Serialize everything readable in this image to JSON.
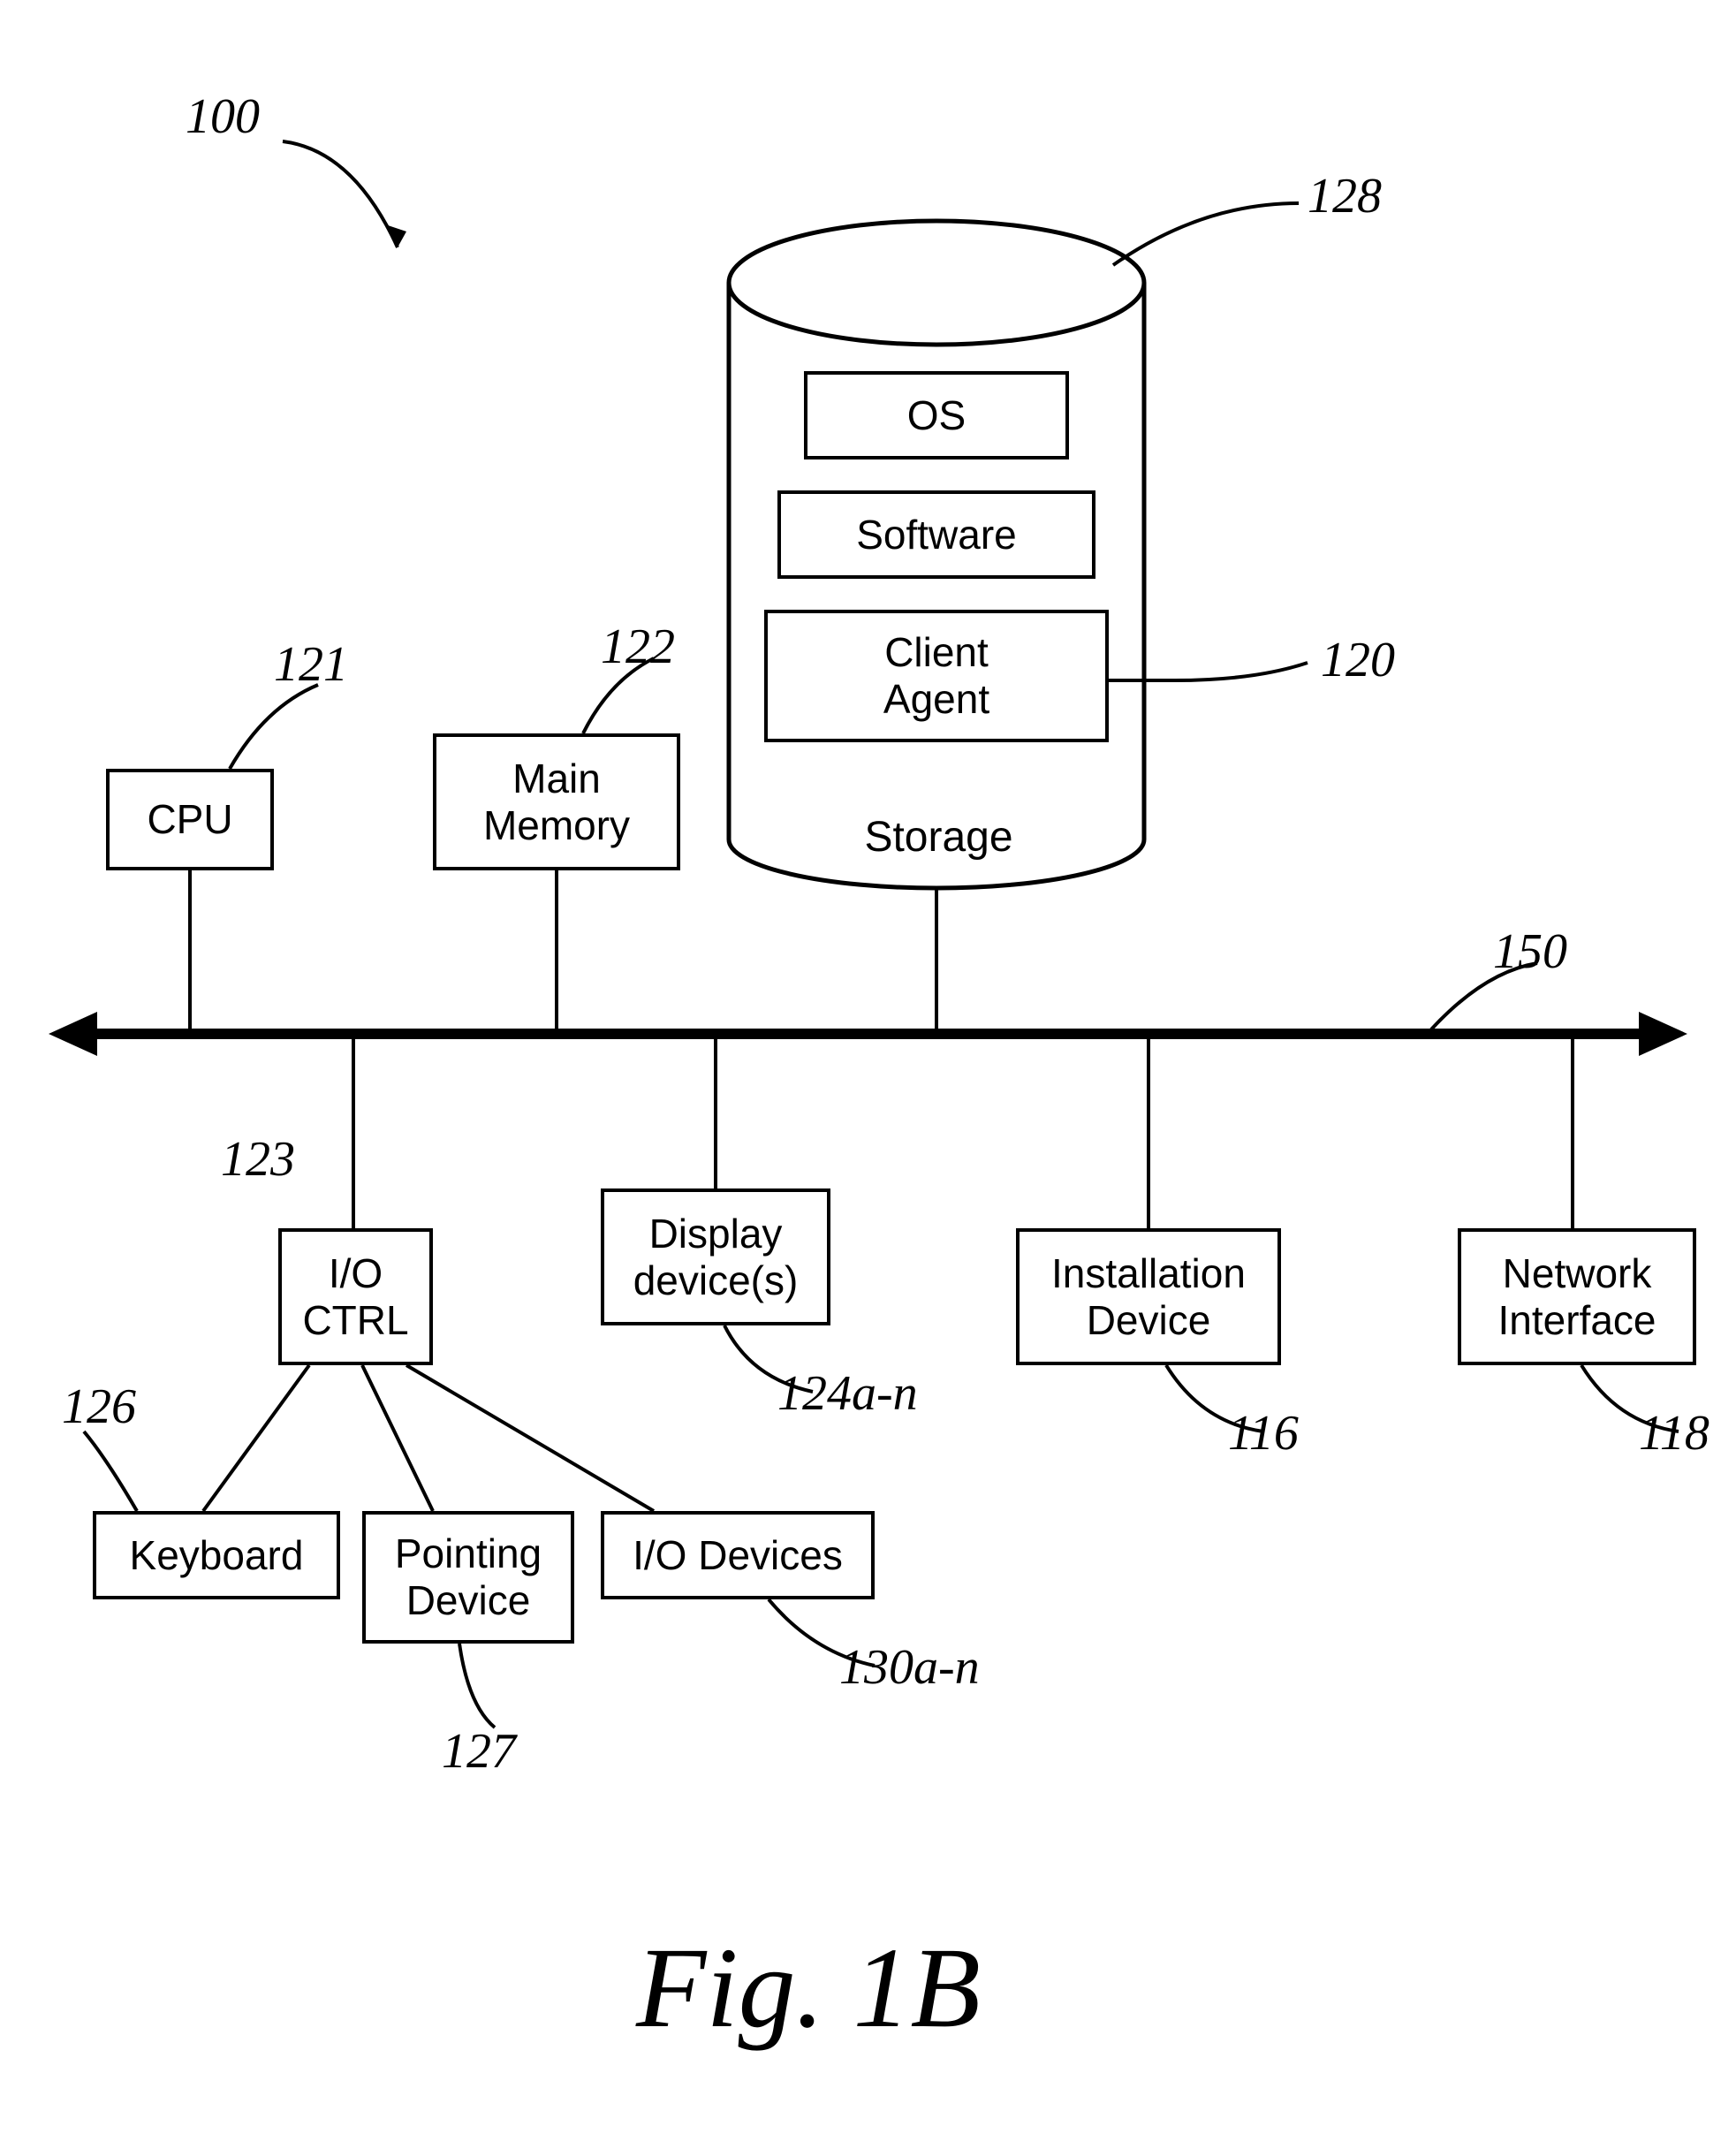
{
  "figure_ref": "100",
  "caption": "Fig. 1B",
  "storage": {
    "label": "Storage",
    "ref": "128",
    "items": {
      "os": "OS",
      "software": "Software",
      "client_agent": "Client\nAgent",
      "client_agent_ref": "120"
    }
  },
  "bus_ref": "150",
  "top_blocks": {
    "cpu": {
      "label": "CPU",
      "ref": "121"
    },
    "main_memory": {
      "label": "Main\nMemory",
      "ref": "122"
    }
  },
  "bottom_blocks": {
    "io_ctrl": {
      "label": "I/O\nCTRL",
      "ref": "123"
    },
    "display": {
      "label": "Display\ndevice(s)",
      "ref": "124a-n"
    },
    "installation": {
      "label": "Installation\nDevice",
      "ref": "116"
    },
    "network": {
      "label": "Network\nInterface",
      "ref": "118"
    },
    "keyboard": {
      "label": "Keyboard",
      "ref": "126"
    },
    "pointing": {
      "label": "Pointing\nDevice",
      "ref": "127"
    },
    "io_devices": {
      "label": "I/O Devices",
      "ref": "130a-n"
    }
  }
}
